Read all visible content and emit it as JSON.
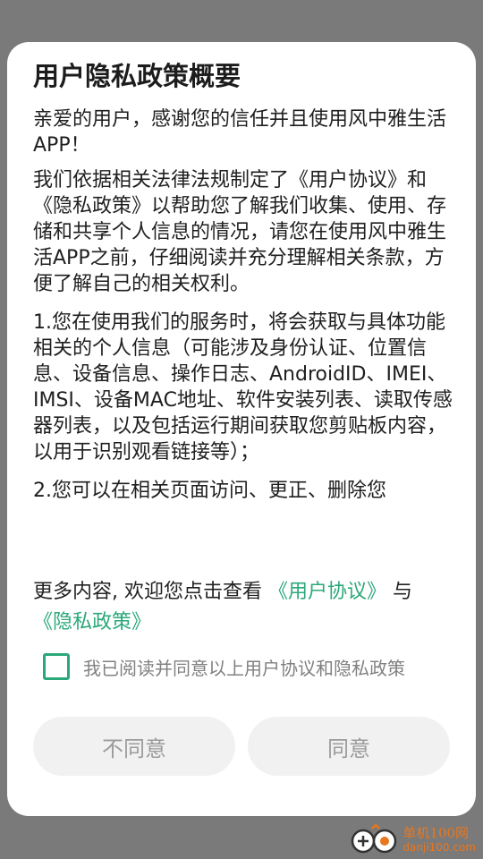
{
  "dialog": {
    "title": "用户隐私政策概要",
    "paragraphs": [
      "亲爱的用户，感谢您的信任并且使用风中雅生活APP！",
      "我们依据相关法律法规制定了《用户协议》和《隐私政策》以帮助您了解我们收集、使用、存储和共享个人信息的情况，请您在使用风中雅生活APP之前，仔细阅读并充分理解相关条款，方便了解自己的相关权利。",
      "1.您在使用我们的服务时，将会获取与具体功能相关的个人信息（可能涉及身份认证、位置信息、设备信息、操作日志、AndroidID、IMEI、IMSI、设备MAC地址、软件安装列表、读取传感器列表，以及包括运行期间获取您剪贴板内容，以用于识别观看链接等）；",
      "2.您可以在相关页面访问、更正、删除您"
    ],
    "more_prefix": "更多内容, 欢迎您点击查看",
    "user_agreement_link": "《用户协议》",
    "more_and": " 与",
    "privacy_policy_link": "《隐私政策》",
    "agree_label": "我已阅读并同意以上用户协议和隐私政策",
    "agree_checked": false,
    "decline_label": "不同意",
    "accept_label": "同意"
  },
  "watermark": {
    "name": "单机100网",
    "domain": "danji100.com"
  },
  "colors": {
    "accent": "#2ba87a",
    "watermark": "#e8771f",
    "overlay": "#7a7a7a",
    "button_bg": "#f1f1f1"
  }
}
